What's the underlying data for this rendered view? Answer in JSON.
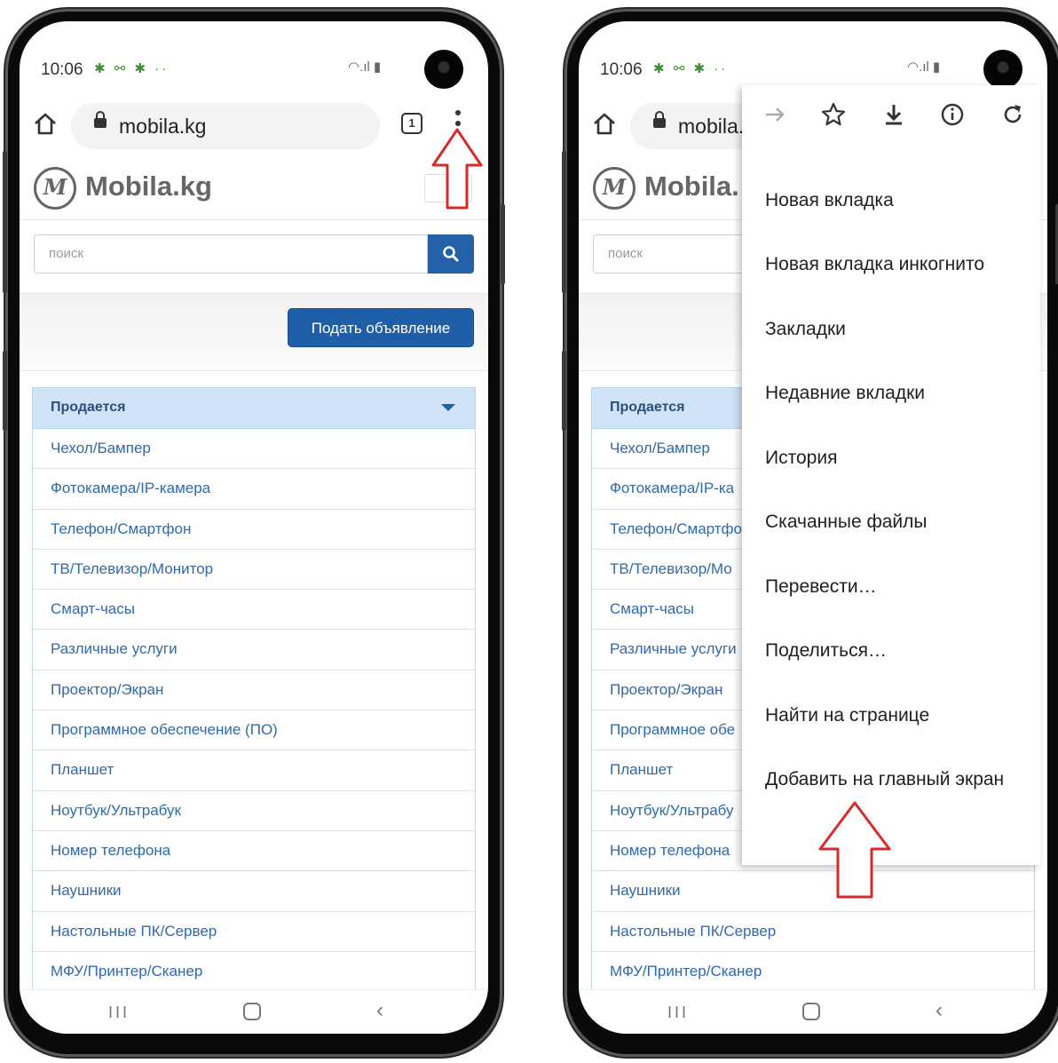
{
  "status_bar": {
    "time": "10:06",
    "notif_icons": "✱ ⚯ ✱ ··",
    "sys_icons": "◠.ıl ▮"
  },
  "browser": {
    "url": "mobila.kg",
    "url_truncated": "mobila.",
    "tab_count": "1"
  },
  "site": {
    "logo_mark": "M",
    "logo_text": "Mobila.kg",
    "logo_text_truncated": "Mobila.",
    "search_placeholder": "поиск",
    "post_button": "Подать объявление"
  },
  "categories": {
    "header": "Продается",
    "items": [
      "Чехол/Бампер",
      "Фотокамера/IP-камера",
      "Телефон/Смартфон",
      "ТВ/Телевизор/Монитор",
      "Смарт-часы",
      "Различные услуги",
      "Проектор/Экран",
      "Программное обеспечение (ПО)",
      "Планшет",
      "Ноутбук/Ультрабук",
      "Номер телефона",
      "Наушники",
      "Настольные ПК/Сервер",
      "МФУ/Принтер/Сканер"
    ],
    "items_truncated": [
      "Чехол/Бампер",
      "Фотокамера/IP-ка",
      "Телефон/Смартфо",
      "ТВ/Телевизор/Мо",
      "Смарт-часы",
      "Различные услуги",
      "Проектор/Экран",
      "Программное обе",
      "Планшет",
      "Ноутбук/Ультрабу",
      "Номер телефона",
      "Наушники",
      "Настольные ПК/Сервер",
      "МФУ/Принтер/Сканер"
    ]
  },
  "menu": {
    "icons": [
      "forward-icon",
      "star-icon",
      "download-icon",
      "info-icon",
      "refresh-icon"
    ],
    "items": [
      "Новая вкладка",
      "Новая вкладка инкогнито",
      "Закладки",
      "Недавние вкладки",
      "История",
      "Скачанные файлы",
      "Перевести…",
      "Поделиться…",
      "Найти на странице",
      "Добавить на главный экран"
    ]
  },
  "nav": {
    "recents": "III",
    "back": "‹"
  },
  "colors": {
    "link": "#2f6aa8",
    "primary_button": "#1f5ea8",
    "category_header_bg": "#cfe4f7",
    "annotation_arrow": "#d42b2b"
  }
}
